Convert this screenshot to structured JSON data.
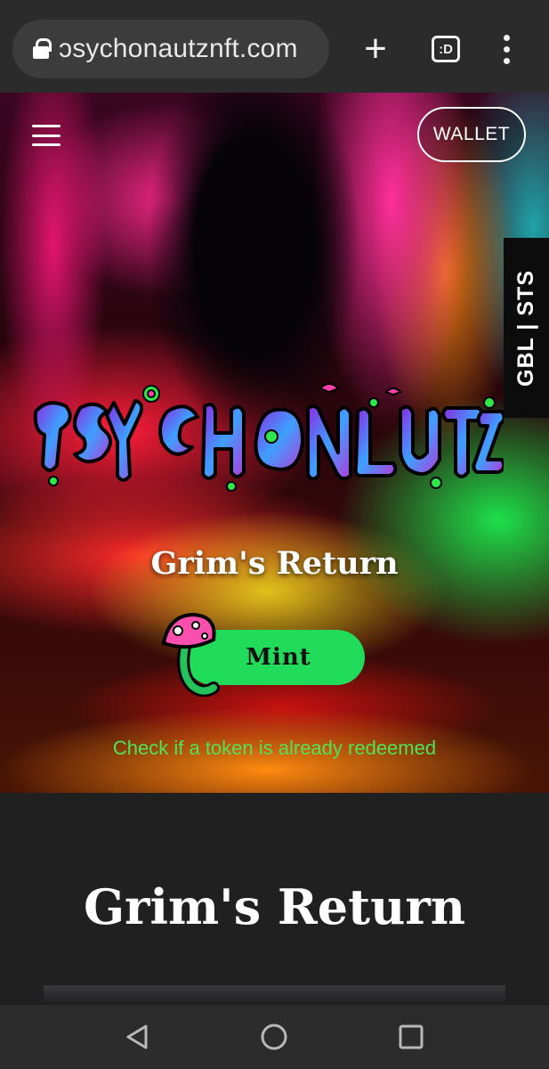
{
  "browser": {
    "url": "ɔsychonautznft.com",
    "tabs_label": ":D"
  },
  "header": {
    "wallet_label": "WALLET",
    "side_tab_label": "GBL | STS"
  },
  "hero": {
    "title": "Grim's Return",
    "mint_label": "Mint",
    "check_link": "Check if a token is already redeemed"
  },
  "section": {
    "title": "Grim's Return"
  },
  "colors": {
    "accent_green": "#21dc5a",
    "link_green": "#4fe35a",
    "page_bg": "#202020"
  },
  "icons": [
    "lock-icon",
    "plus-icon",
    "tab-switcher-icon",
    "overflow-menu-icon",
    "hamburger-menu-icon",
    "mushroom-icon",
    "back-icon",
    "home-icon",
    "recents-icon"
  ]
}
